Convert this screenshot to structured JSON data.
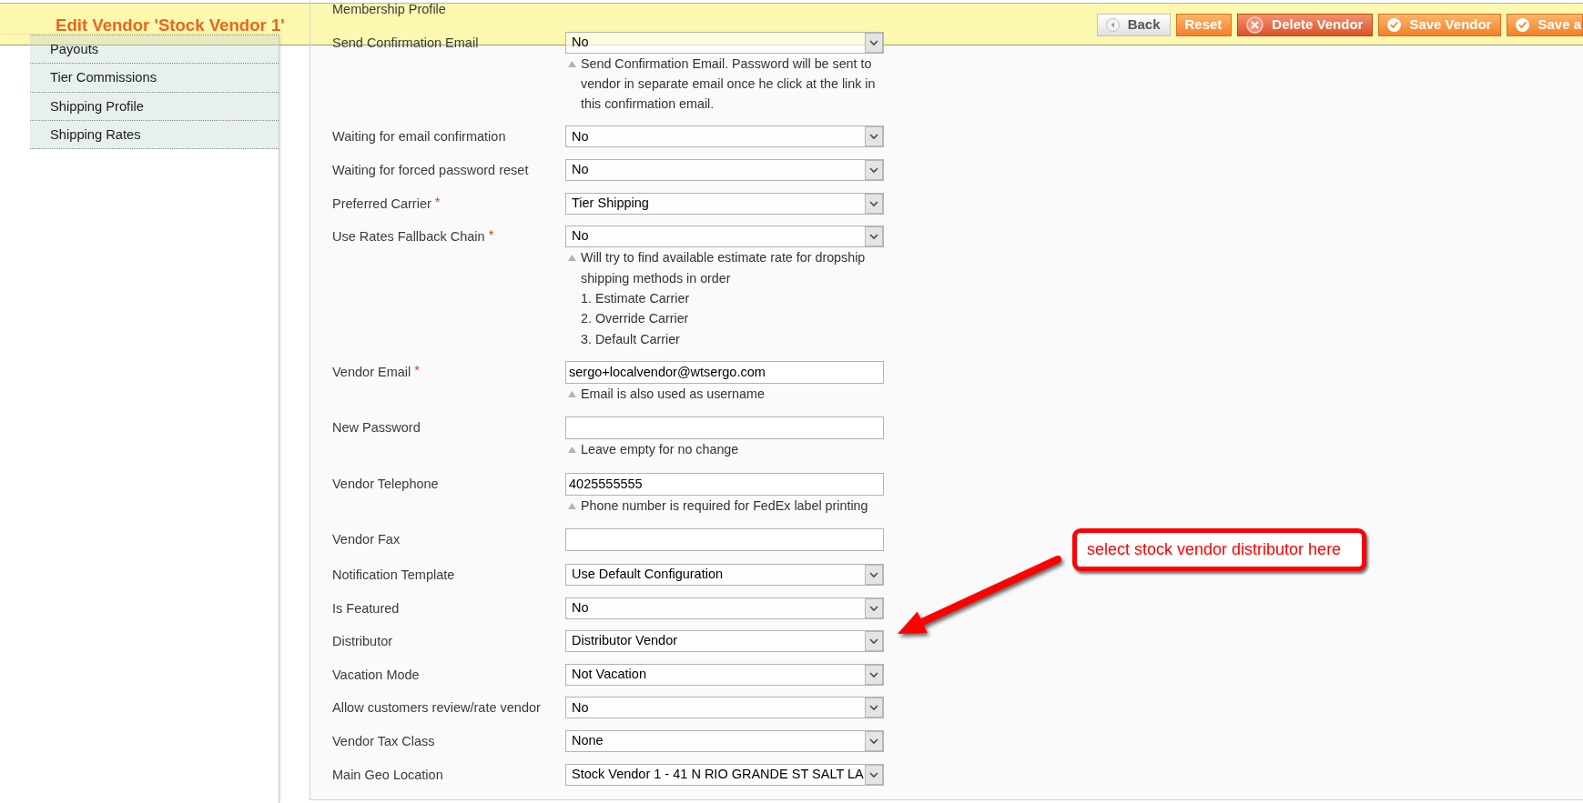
{
  "header": {
    "title": "Edit Vendor 'Stock Vendor 1'",
    "buttons": [
      {
        "label": "Back",
        "kind": "back"
      },
      {
        "label": "Reset",
        "kind": "reset"
      },
      {
        "label": "Delete Vendor",
        "kind": "delete"
      },
      {
        "label": "Save Vendor",
        "kind": "save"
      },
      {
        "label": "Save a",
        "kind": "save"
      }
    ]
  },
  "sidebar": {
    "items": [
      "Payouts",
      "Tier Commissions",
      "Shipping Profile",
      "Shipping Rates"
    ]
  },
  "form": {
    "rows": [
      {
        "label": "Membership Profile"
      },
      {
        "label": "Send Confirmation Email",
        "field": {
          "kind": "select",
          "value": "No"
        },
        "note": {
          "text": "Send Confirmation Email. Password will be sent to vendor in separate email once he click at the link in this confirmation email."
        }
      },
      {
        "label": "Waiting for email confirmation",
        "field": {
          "kind": "select",
          "value": "No"
        }
      },
      {
        "label": "Waiting for forced password reset",
        "field": {
          "kind": "select",
          "value": "No"
        }
      },
      {
        "label": "Preferred Carrier",
        "required_mark": "*",
        "field": {
          "kind": "select",
          "value": "Tier Shipping"
        }
      },
      {
        "label": "Use Rates Fallback Chain",
        "required_mark": "*",
        "field": {
          "kind": "select",
          "value": "No"
        },
        "note": {
          "text": "Will try to find available estimate rate for dropship shipping methods in order",
          "lines": [
            "1. Estimate Carrier",
            "2. Override Carrier",
            "3. Default Carrier"
          ]
        }
      },
      {
        "label": "Vendor Email",
        "required_mark": "*",
        "field": {
          "kind": "input",
          "value": "sergo+localvendor@wtsergo.com"
        },
        "note": {
          "text": "Email is also used as username"
        }
      },
      {
        "label": "New Password",
        "field": {
          "kind": "input"
        },
        "note": {
          "text": "Leave empty for no change"
        }
      },
      {
        "label": "Vendor Telephone",
        "field": {
          "kind": "input",
          "value": "4025555555"
        },
        "note": {
          "text": "Phone number is required for FedEx label printing"
        }
      },
      {
        "label": "Vendor Fax",
        "field": {
          "kind": "input"
        }
      },
      {
        "label": "Notification Template",
        "field": {
          "kind": "select",
          "value": "Use Default Configuration"
        }
      },
      {
        "label": "Is Featured",
        "field": {
          "kind": "select",
          "value": "No"
        }
      },
      {
        "label": "Distributor",
        "field": {
          "kind": "select",
          "value": "Distributor Vendor"
        }
      },
      {
        "label": "Vacation Mode",
        "field": {
          "kind": "select",
          "value": "Not Vacation"
        }
      },
      {
        "label": "Allow customers review/rate vendor",
        "field": {
          "kind": "select",
          "value": "No"
        }
      },
      {
        "label": "Vendor Tax Class",
        "field": {
          "kind": "select",
          "value": "None"
        }
      },
      {
        "label": "Main Geo Location",
        "field": {
          "kind": "select",
          "value": "Stock Vendor 1 - 41 N RIO GRANDE ST SALT LA"
        }
      }
    ]
  },
  "annotation": {
    "text": "select stock vendor distributor here"
  }
}
